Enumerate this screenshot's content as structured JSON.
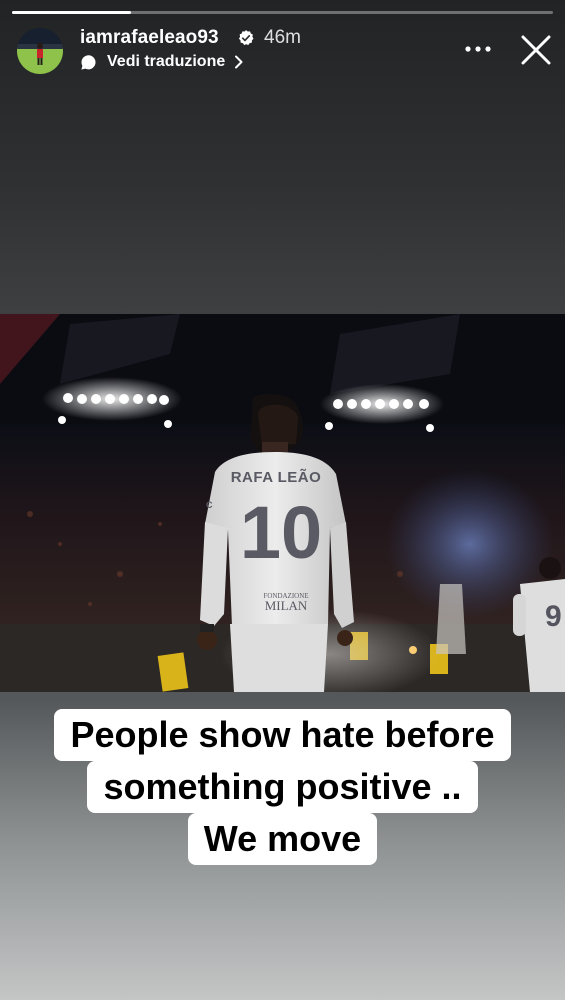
{
  "story": {
    "progress": 0.22,
    "username": "iamrafaeleao93",
    "verified": true,
    "time_ago": "46m",
    "translate_label": "Vedi traduzione"
  },
  "icons": {
    "verified": "verified-badge-icon",
    "translate": "speech-bubble-icon",
    "chevron": "chevron-right-icon",
    "more": "more-options-icon",
    "close": "close-icon"
  },
  "photo": {
    "jersey_name": "RAFA LEÃO",
    "jersey_number": "10",
    "sponsor_line1": "FONDAZIONE",
    "sponsor_line2": "MILAN",
    "teammate_number": "9"
  },
  "caption": {
    "lines": [
      "People show hate before",
      "something positive ..",
      "We move"
    ]
  },
  "colors": {
    "caption_bg": "#ffffff",
    "caption_text": "#000000",
    "jersey": "#e9e9e9",
    "jersey_number": "#5a5a64"
  }
}
